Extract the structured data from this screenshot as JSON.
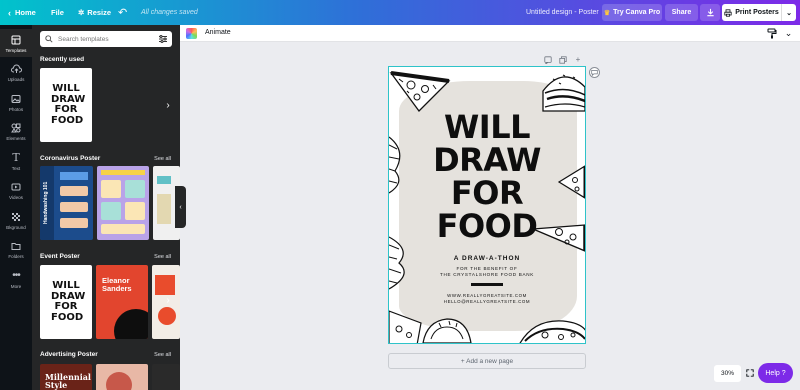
{
  "topbar": {
    "home": "Home",
    "file": "File",
    "resize": "Resize",
    "saved": "All changes saved",
    "doc_title": "Untitled design - Poster",
    "try_pro": "Try Canva Pro",
    "share": "Share",
    "print": "Print Posters"
  },
  "rail": {
    "items": [
      {
        "label": "Templates",
        "icon": "template-icon"
      },
      {
        "label": "Uploads",
        "icon": "upload-icon"
      },
      {
        "label": "Photos",
        "icon": "photo-icon"
      },
      {
        "label": "Elements",
        "icon": "elements-icon"
      },
      {
        "label": "Text",
        "icon": "text-icon"
      },
      {
        "label": "Videos",
        "icon": "video-icon"
      },
      {
        "label": "Bkground",
        "icon": "background-icon"
      },
      {
        "label": "Folders",
        "icon": "folder-icon"
      },
      {
        "label": "More",
        "icon": "more-icon"
      }
    ]
  },
  "panel": {
    "search_placeholder": "Search templates",
    "sections": [
      {
        "title": "Recently used",
        "see_all": ""
      },
      {
        "title": "Coronavirus Poster",
        "see_all": "See all"
      },
      {
        "title": "Event Poster",
        "see_all": "See all"
      },
      {
        "title": "Advertising Poster",
        "see_all": "See all"
      }
    ],
    "thumbs": {
      "recent_text": "WILL DRAW FOR FOOD",
      "wash_text": "Handwashing 101",
      "eleanor_text": "Eleanor Sanders",
      "millennial_text": "Millennial Style"
    }
  },
  "toolbar": {
    "animate": "Animate"
  },
  "poster": {
    "headline_lines": [
      "WILL",
      "DRAW",
      "FOR",
      "FOOD"
    ],
    "subtitle": "A DRAW-A-THON",
    "benefit_line1": "FOR THE BENEFIT OF",
    "benefit_line2": "THE CRYSTALSHORE FOOD BANK",
    "website": "WWW.REALLYGREATSITE.COM",
    "email": "HELLO@REALLYGREATSITE.COM"
  },
  "canvas": {
    "add_page": "+ Add a new page",
    "zoom": "30%",
    "help": "Help ?"
  },
  "colors": {
    "brand_gradient_start": "#01c3cc",
    "brand_gradient_end": "#7d2ae8",
    "selection": "#2ec3c9",
    "help_purple": "#7d2ae8"
  }
}
